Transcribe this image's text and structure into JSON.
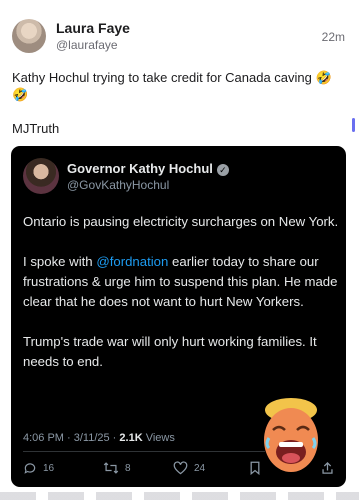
{
  "post": {
    "author_name": "Laura Faye",
    "author_handle": "@laurafaye",
    "time": "22m",
    "text": "Kathy Hochul trying to take credit for Canada caving 🤣🤣",
    "hashtag": "MJTruth"
  },
  "embedded": {
    "author_name": "Governor Kathy Hochul",
    "author_handle": "@GovKathyHochul",
    "paragraph1": "Ontario is pausing electricity surcharges on New York.",
    "paragraph2_before": "I spoke with ",
    "paragraph2_mention": "@fordnation",
    "paragraph2_after": " earlier today to share our frustrations & urge him to suspend this plan. He made clear that he does not want to hurt New Yorkers.",
    "paragraph3": "Trump's trade war will only hurt working families. It needs to end.",
    "time": "4:06 PM · 3/11/25 · ",
    "views_count": "2.1K",
    "views_label": " Views",
    "replies": "16",
    "reposts": "8",
    "likes": "24"
  },
  "icons": {
    "verified": "verified-badge-icon",
    "reply": "reply-icon",
    "repost": "repost-icon",
    "like": "heart-icon",
    "bookmark": "bookmark-icon",
    "share": "share-icon"
  },
  "colors": {
    "mention": "#1d9bf0",
    "embedded_bg": "#000000",
    "meta_gray": "#8b98a5"
  }
}
